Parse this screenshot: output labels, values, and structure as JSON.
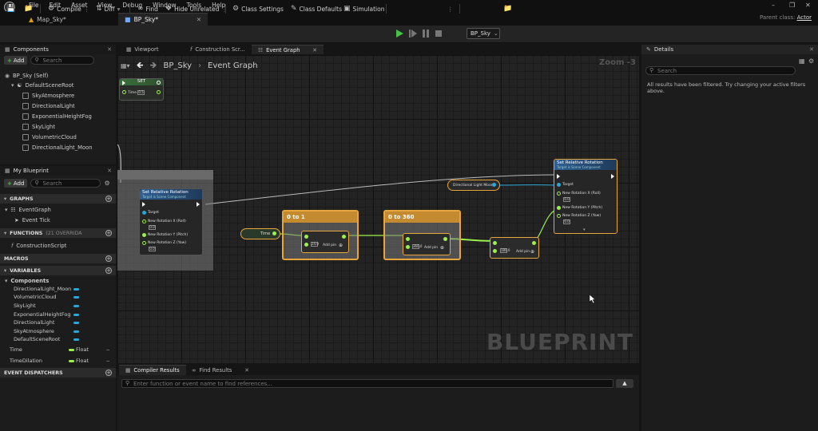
{
  "menubar": {
    "items": [
      "File",
      "Edit",
      "Asset",
      "View",
      "Debug",
      "Window",
      "Tools",
      "Help"
    ]
  },
  "tabs": [
    {
      "label": "Map_Sky*"
    },
    {
      "label": "BP_Sky*"
    }
  ],
  "parent_class": {
    "label": "Parent class:",
    "value": "Actor"
  },
  "toolbar": {
    "compile": "Compile",
    "diff": "Diff",
    "find": "Find",
    "hide_unrelated": "Hide Unrelated",
    "class_settings": "Class Settings",
    "class_defaults": "Class Defaults",
    "simulation": "Simulation",
    "debug_object": "BP_Sky"
  },
  "components_panel": {
    "title": "Components",
    "add_label": "Add",
    "search_placeholder": "Search",
    "root": "BP_Sky (Self)",
    "scene_root": "DefaultSceneRoot",
    "children": [
      "SkyAtmosphere",
      "DirectionalLight",
      "ExponentialHeightFog",
      "SkyLight",
      "VolumetricCloud",
      "DirectionalLight_Moon"
    ]
  },
  "my_blueprint": {
    "title": "My Blueprint",
    "add_label": "Add",
    "search_placeholder": "Search",
    "graphs_label": "GRAPHS",
    "event_graph": "EventGraph",
    "event_tick": "Event Tick",
    "functions_label": "FUNCTIONS",
    "functions_count": "(21 OVERRIDA",
    "construction_script": "ConstructionScript",
    "macros_label": "MACROS",
    "variables_label": "VARIABLES",
    "components_label": "Components",
    "component_vars": [
      "DirectionalLight_Moon",
      "VolumetricCloud",
      "SkyLight",
      "ExponentialHeightFog",
      "DirectionalLight",
      "SkyAtmosphere",
      "DefaultSceneRoot"
    ],
    "vars": [
      {
        "name": "Time",
        "type": "Float"
      },
      {
        "name": "TimeDilation",
        "type": "Float"
      }
    ],
    "event_dispatchers_label": "EVENT DISPATCHERS"
  },
  "center_tabs": [
    "Viewport",
    "Construction Scr...",
    "Event Graph"
  ],
  "breadcrumb": {
    "blueprint": "BP_Sky",
    "graph": "Event Graph"
  },
  "zoom_label": "Zoom -3",
  "watermark": "BLUEPRINT",
  "graph": {
    "set_node": {
      "title": "SET",
      "pin_label": "Time",
      "value": "0.5"
    },
    "set_rel_rot_a": {
      "title": "Set Relative Rotation",
      "subtitle": "Target is Scene Component",
      "target": "Target",
      "roll": "New Rotation X (Roll)",
      "pitch": "New Rotation Y (Pitch)",
      "yaw": "New Rotation Z (Yaw)",
      "roll_val": "0.0",
      "yaw_val": "0.0"
    },
    "set_rel_rot_b": {
      "title": "Set Relative Rotation",
      "subtitle": "Target is Scene Component",
      "target": "Target",
      "roll": "New Rotation X (Roll)",
      "pitch": "New Rotation Y (Pitch)",
      "yaw": "New Rotation Z (Yaw)",
      "roll_val": "0.0",
      "yaw_val": "0.0"
    },
    "time_node": "Time",
    "moon_node": "Directional Light Moon",
    "comment_a": {
      "title": "0 to 1",
      "value": "24.0",
      "add_pin": "Add pin"
    },
    "comment_b": {
      "title": "0 to 360",
      "value": "360.0",
      "add_pin": "Add pin"
    },
    "add_node": {
      "value": "180.0",
      "add_pin": "Add pin"
    }
  },
  "bottom_panel": {
    "tabs": [
      "Compiler Results",
      "Find Results"
    ],
    "search_placeholder": "Enter function or event name to find references..."
  },
  "details_panel": {
    "title": "Details",
    "search_placeholder": "Search",
    "message": "All results have been filtered. Try changing your active filters above."
  },
  "colors": {
    "accent_green": "#46c346",
    "comment_orange": "#e8a53a",
    "exec_white": "#ffffff",
    "float_pin": "#9cf04b",
    "object_pin": "#2aa6d9"
  }
}
